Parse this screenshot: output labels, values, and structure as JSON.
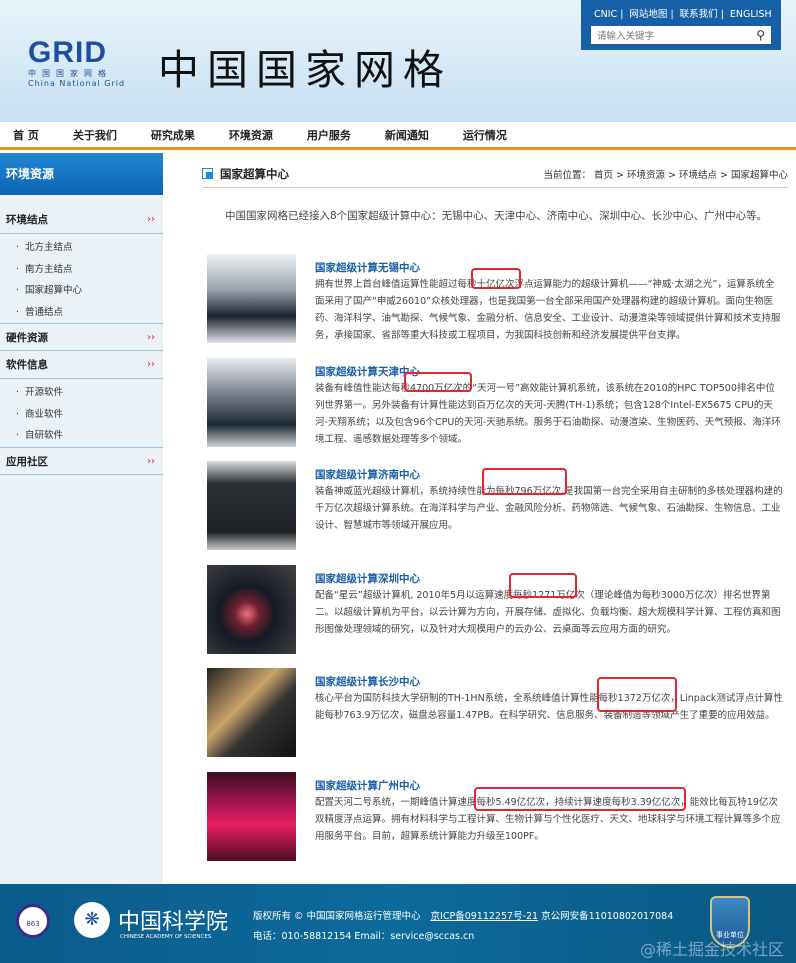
{
  "header": {
    "logo": "GRID",
    "logo_cn": "中国国家网格",
    "logo_en": "China National Grid",
    "title": "中国国家网格",
    "toplinks": [
      "CNIC",
      "网站地图",
      "联系我们",
      "ENGLISH"
    ],
    "search_placeholder": "请输入关键字"
  },
  "nav": [
    "首 页",
    "关于我们",
    "研究成果",
    "环境资源",
    "用户服务",
    "新闻通知",
    "运行情况"
  ],
  "sidebar": {
    "title": "环境资源",
    "arrow": "››",
    "sections": [
      {
        "label": "环境结点",
        "items": [
          "北方主结点",
          "南方主结点",
          "国家超算中心",
          "普通结点"
        ]
      },
      {
        "label": "硬件资源",
        "items": []
      },
      {
        "label": "软件信息",
        "items": [
          "开源软件",
          "商业软件",
          "自研软件"
        ]
      },
      {
        "label": "应用社区",
        "items": []
      }
    ]
  },
  "main": {
    "title": "国家超算中心",
    "breadcrumb": "当前位置： 首页 > 环境资源 > 环境结点 > 国家超算中心",
    "intro": "中国国家网格已经接入8个国家超级计算中心：无锡中心、天津中心、济南中心、深圳中心、长沙中心、广州中心等。",
    "centers": [
      {
        "title": "国家超级计算无锡中心",
        "text": "拥有世界上首台峰值运算性能超过每秒十亿亿次浮点运算能力的超级计算机——“神威·太湖之光”，运算系统全面采用了国产“申威26010”众核处理器，也是我国第一台全部采用国产处理器构建的超级计算机。面向生物医药、海洋科学、油气勘探、气候气象、金融分析、信息安全、工业设计、动漫渲染等领域提供计算和技术支持服务，承接国家、省部等重大科技或工程项目，为我国科技创新和经济发展提供平台支撑。"
      },
      {
        "title": "国家超级计算天津中心",
        "text": "装备有峰值性能达每秒4700万亿次的“天河一号”高效能计算机系统，该系统在2010的HPC TOP500排名中位列世界第一。另外装备有计算性能达到百万亿次的天河-天腾(TH-1)系统；包含128个Intel-EX5675 CPU的天河-天翔系统；以及包含96个CPU的天河-天驰系统。服务于石油勘探、动漫渲染、生物医药、天气预报、海洋环境工程、遥感数据处理等多个领域。"
      },
      {
        "title": "国家超级计算济南中心",
        "text": "装备神威蓝光超级计算机，系统持续性能为每秒796万亿次,是我国第一台完全采用自主研制的多核处理器构建的千万亿次超级计算系统。在海洋科学与产业、金融风险分析、药物筛选、气候气象、石油勘探、生物信息、工业设计、智慧城市等领域开展应用。"
      },
      {
        "title": "国家超级计算深圳中心",
        "text": "配备“星云”超级计算机, 2010年5月以运算速度每秒1271万亿次（理论峰值为每秒3000万亿次）排名世界第二。以超级计算机为平台，以云计算为方向，开展存储、虚拟化、负载均衡、超大规模科学计算、工程仿真和图形图像处理领域的研究，以及针对大规模用户的云办公、云桌面等云应用方面的研究。"
      },
      {
        "title": "国家超级计算长沙中心",
        "text": "核心平台为国防科技大学研制的TH-1HN系统，全系统峰值计算性能每秒1372万亿次，Linpack测试浮点计算性能每秒763.9万亿次，磁盘总容量1.47PB。在科学研究、信息服务、装备制造等领域产生了重要的应用效益。"
      },
      {
        "title": "国家超级计算广州中心",
        "text": "配置天河二号系统，一期峰值计算速度每秒5.49亿亿次，持续计算速度每秒3.39亿亿次，能效比每瓦特19亿次双精度浮点运算。拥有材料科学与工程计算、生物计算与个性化医疗、天文、地球科学与环境工程计算等多个应用服务平台。目前，超算系统计算能力升级至100PF。"
      }
    ]
  },
  "footer": {
    "copyright": "版权所有 © 中国国家网格运行管理中心",
    "icp": "京ICP备09112257号-21",
    "police": "京公网安备11010802017084",
    "contact": "电话：010-58812154 Email：service@sccas.cn",
    "cas_name": "中国科学院",
    "cas_en": "CHINESE ACADEMY OF SCIENCES",
    "seal1": "863",
    "badge": "事业单位",
    "watermark": "@稀土掘金技术社区"
  }
}
